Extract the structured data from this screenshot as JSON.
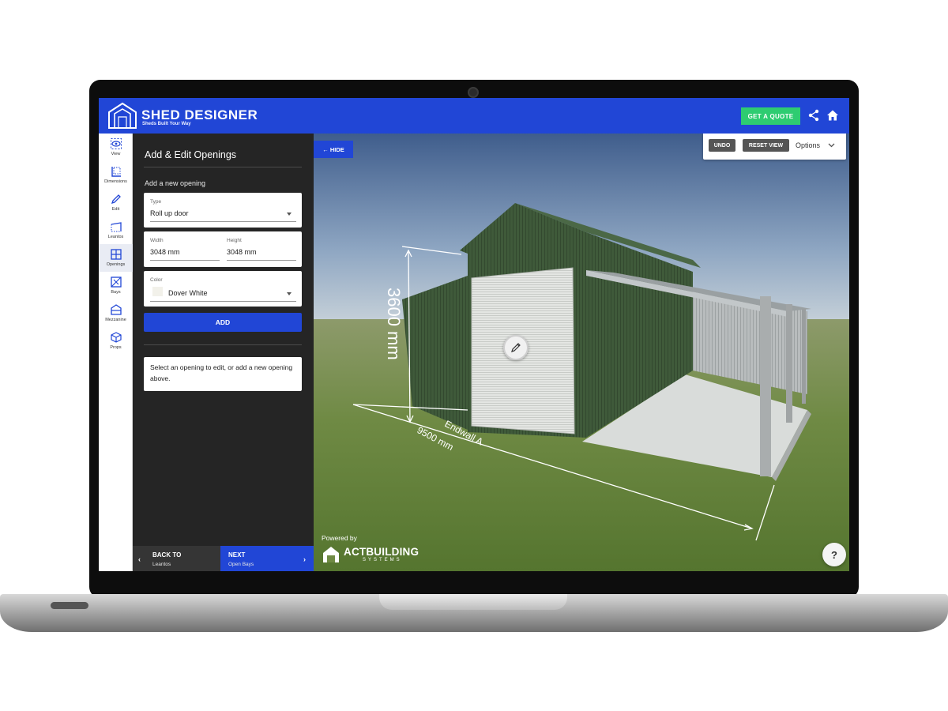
{
  "header": {
    "brand_title": "SHED DESIGNER",
    "brand_subtitle": "Sheds Built Your Way",
    "quote_button": "GET A QUOTE",
    "share_icon": "share-icon",
    "home_icon": "home-icon",
    "color": "#2146d6"
  },
  "rail": {
    "items": [
      {
        "label": "View",
        "icon": "eye-icon"
      },
      {
        "label": "Dimensions",
        "icon": "dimensions-icon"
      },
      {
        "label": "Edit",
        "icon": "pencil-icon"
      },
      {
        "label": "Leantos",
        "icon": "leanto-icon"
      },
      {
        "label": "Openings",
        "icon": "openings-icon",
        "active": true
      },
      {
        "label": "Bays",
        "icon": "bays-icon"
      },
      {
        "label": "Mezzanine",
        "icon": "mezzanine-icon"
      },
      {
        "label": "Props",
        "icon": "cube-icon"
      }
    ]
  },
  "panel": {
    "title": "Add & Edit Openings",
    "section_label": "Add a new opening",
    "type": {
      "label": "Type",
      "value": "Roll up door"
    },
    "width": {
      "label": "Width",
      "value": "3048 mm"
    },
    "height": {
      "label": "Height",
      "value": "3048 mm"
    },
    "color": {
      "label": "Color",
      "value": "Dover White",
      "swatch": "#f2f1ea"
    },
    "add_button": "ADD",
    "hint": "Select an opening to edit, or add a new opening above.",
    "back": {
      "label": "BACK TO",
      "target": "Leantos"
    },
    "next": {
      "label": "NEXT",
      "target": "Open Bays"
    }
  },
  "viewport": {
    "hide_button": "← HIDE",
    "undo_button": "UNDO",
    "reset_button": "RESET VIEW",
    "options_label": "Options",
    "dimension_height": "3600 mm",
    "dimension_endwall": "Endwall A",
    "dimension_width": "9500 mm",
    "powered_by": "Powered by",
    "act_name": "ACTBUILDING",
    "act_sub": "SYSTEMS",
    "help_button": "?",
    "shed_color": "#3f5a3a",
    "door_color": "#e4e6e3"
  }
}
